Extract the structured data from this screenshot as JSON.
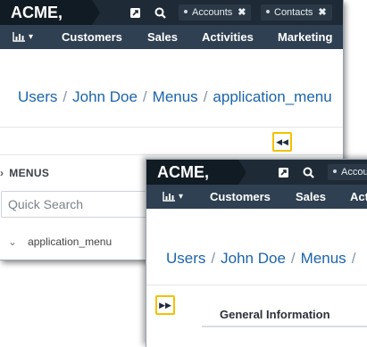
{
  "window_back": {
    "brand": "ACME, INC",
    "tabs": [
      {
        "label": "Accounts"
      },
      {
        "label": "Contacts"
      }
    ],
    "nav": {
      "dashboard_icon": "bar-chart-icon",
      "items": [
        "Customers",
        "Sales",
        "Activities",
        "Marketing"
      ]
    },
    "breadcrumb": [
      "Users",
      "John Doe",
      "Menus",
      "application_menu"
    ],
    "sidebar": {
      "heading": "MENUS",
      "search_placeholder": "Quick Search",
      "tree_item": "application_menu"
    }
  },
  "window_front": {
    "brand": "ACME, INC",
    "tabs": [
      {
        "label": "Accou"
      }
    ],
    "nav": {
      "items": [
        "Customers",
        "Sales",
        "Act"
      ]
    },
    "breadcrumb": [
      "Users",
      "John Doe",
      "Menus"
    ],
    "section_tab": "General Information"
  },
  "colors": {
    "topbar": "#1e2b37",
    "brand_bg": "#111b24",
    "navbar": "#2e4051",
    "link": "#1b64a9",
    "highlight": "#f2c200"
  }
}
